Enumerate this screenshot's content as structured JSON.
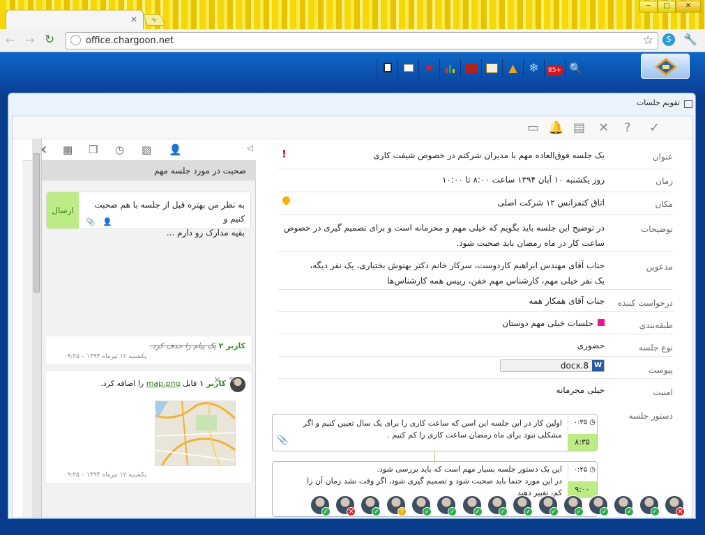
{
  "browser": {
    "url": "office.chargoon.net"
  },
  "app": {
    "toolbar_icons": [
      "logout-icon",
      "windows-icon",
      "favorite-star-icon",
      "chart-icon",
      "briefcase-icon",
      "contacts-book-icon",
      "warning-icon",
      "snowflake-icon",
      "notification-count-icon",
      "search-icon"
    ],
    "notification_count": "85+"
  },
  "window": {
    "title": "تقویم جلسات"
  },
  "meeting": {
    "subject_label": "عنوان",
    "subject": "یک جلسه فوق‌العاده مهم با مدیران شرکتم در خصوص شیفت کاری",
    "important_mark": "!",
    "time_label": "زمان",
    "time": "روز یکشنبه ۱۰ آبان ۱۳۹۴   ساعت ۸:۰۰ تا ۱۰:۰۰",
    "place_label": "مکان",
    "place": "اتاق کنفرانس ۱۲ شرکت اصلی",
    "desc_label": "توضیحات",
    "desc_line1": "در توضیح این جلسه باید بگویم که خیلی مهم و محرمانه است و برای تصمیم گیری در خصوص",
    "desc_line2": "ساعت کار در ماه رمضان باید صحبت شود.",
    "invitees_label": "مدعوین",
    "invitees_line1": "جناب آقای مهندس ابراهیم کاردوست، سرکار خانم دکتر بهنوش بختیاری، یک نفر دیگه،",
    "invitees_line2": "یک نفر خیلی مهم، کارشناس مهم خفن، رییس همه کارشناس‌ها",
    "requester_label": "درخواست کننده",
    "requester": "جناب آقای همکار همه",
    "category_label": "طبقه‌بندی",
    "category": "جلسات خیلی مهم دوستان",
    "category_color": "#e6198c",
    "type_label": "نوع جلسه",
    "type": "حضوری",
    "attachment_label": "پیوست",
    "attachment": "docx.8",
    "security_label": "امنیت",
    "security": "خیلی محرمانه",
    "agenda_label": "دستور جلسه",
    "agenda": [
      {
        "duration": "۰:۳۵",
        "time": "۸:۳۵",
        "line1": "اولین کار در این جلسه این اسن که ساعت کاری را برای یک سال تعیین کنیم و اگر",
        "line2": "مشکلی نبود برای ماه رمضان ساعت کاری را کم کنیم ."
      },
      {
        "duration": "۰:۲۵",
        "time": "۹:۰۰",
        "line1": "این یک دستور جلسه بسیار مهم است که باید بررسی شود.",
        "line2": "در این مورد حتما باید صحبت شود و تصمیم گیری شود، اگر وقت نشد زمان آن را",
        "line3": "کم، تغییر دهید"
      }
    ]
  },
  "chat": {
    "header": "صحبت در مورد جلسه مهم",
    "compose_line1": "به نظر من بهتره قبل از جلسه با هم صحبت کنیم و",
    "compose_line2": "بقیه مدارک رو دارم ...",
    "send_label": "ارسال",
    "messages": [
      {
        "user": "کاربر ۲",
        "text": "یک پیام را حذف کرد.",
        "date": "یکشنبه ۱۲ تیرماه ۱۳۹۴ – ۰۹:۲۵"
      },
      {
        "user": "کاربر ۱",
        "text_pre": "فایل",
        "file": "map.png",
        "text_post": "را اضافه کرد.",
        "date": "یکشنبه ۱۲ تیرماه ۱۳۹۴ – ۰۹:۲۵"
      }
    ]
  },
  "attendees": [
    {
      "status": "invalid"
    },
    {
      "status": "ok"
    },
    {
      "status": "ok"
    },
    {
      "status": "ok"
    },
    {
      "status": "ok"
    },
    {
      "status": "ok"
    },
    {
      "status": "ok"
    },
    {
      "status": "ok"
    },
    {
      "status": "ok"
    },
    {
      "status": "ok"
    },
    {
      "status": "ok"
    },
    {
      "status": "question"
    },
    {
      "status": "ok"
    },
    {
      "status": "invalid"
    },
    {
      "status": "ok"
    }
  ]
}
